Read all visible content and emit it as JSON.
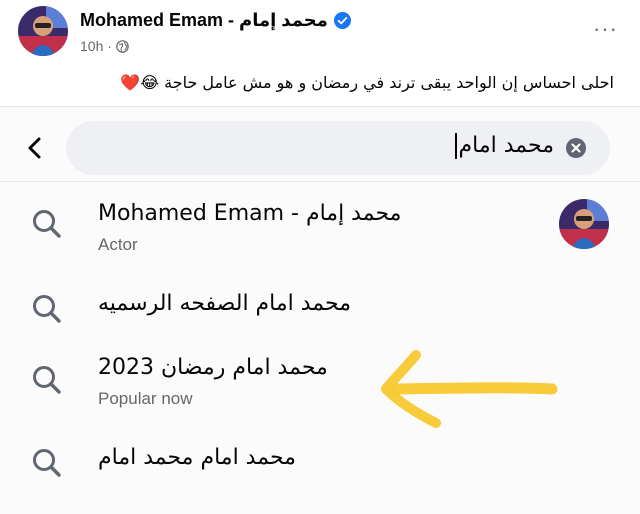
{
  "post": {
    "author_name": "Mohamed Emam - محمد إمام",
    "time": "10h ·",
    "text": "احلى احساس إن الواحد يبقى ترند في رمضان و هو مش عامل حاجة 😂❤️",
    "more_label": "···"
  },
  "search": {
    "query": "محمد امام",
    "back_icon": "chevron-left-icon",
    "clear_icon": "clear-icon"
  },
  "results": [
    {
      "title": "Mohamed Emam - محمد إمام",
      "subtitle": "Actor"
    },
    {
      "title": "محمد امام الصفحه الرسميه",
      "subtitle": ""
    },
    {
      "title": "محمد امام رمضان 2023",
      "subtitle": "Popular now"
    },
    {
      "title": "محمد امام محمد امام",
      "subtitle": ""
    }
  ],
  "colors": {
    "verified_badge": "#1877f2",
    "arrow_annotation": "#f7c526",
    "secondary_text": "#65676b"
  }
}
